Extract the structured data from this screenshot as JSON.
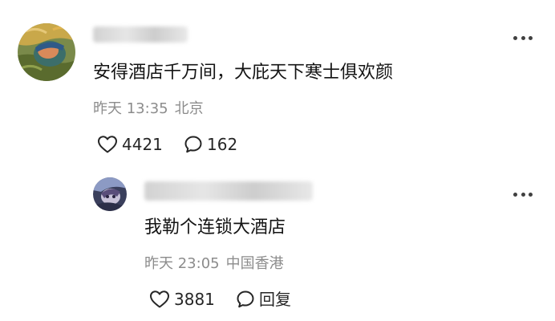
{
  "comment": {
    "text": "安得酒店千万间，大庇天下寒士俱欢颜",
    "time": "昨天 13:35",
    "location": "北京",
    "likes": "4421",
    "replies": "162"
  },
  "reply": {
    "text": "我勒个连锁大酒店",
    "time": "昨天 23:05",
    "location": "中国香港",
    "likes": "3881",
    "reply_label": "回复"
  },
  "icons": {
    "like": "heart-outline-icon",
    "comment": "speech-bubble-icon",
    "more": "more-horizontal-icon"
  },
  "colors": {
    "text": "#141414",
    "meta": "#8c8c8c",
    "icon": "#262626"
  }
}
